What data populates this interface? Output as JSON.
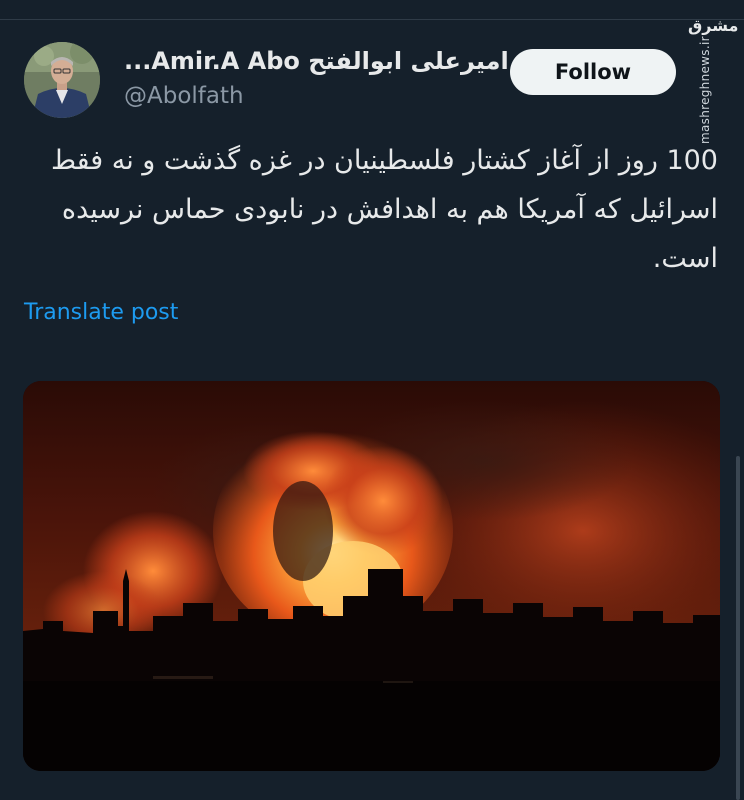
{
  "author": {
    "display_name": "...Amir.A Abo امیرعلی ابوالفتح",
    "handle": "@Abolfath"
  },
  "follow_label": "Follow",
  "tweet": {
    "text": "100 روز از آغاز کشتار فلسطینیان در غزه گذشت و نه فقط اسرائیل که آمریکا هم به اهدافش در نابودی حماس نرسیده است."
  },
  "translate_label": "Translate post",
  "watermark": {
    "logo": "مشرق",
    "url": "mashreghnews.ir"
  },
  "colors": {
    "background": "#15202b",
    "link": "#1d9bf0",
    "text": "#e7e9ea",
    "secondary": "#8b98a5"
  },
  "icons": [
    "avatar-photo",
    "explosion-photo"
  ]
}
